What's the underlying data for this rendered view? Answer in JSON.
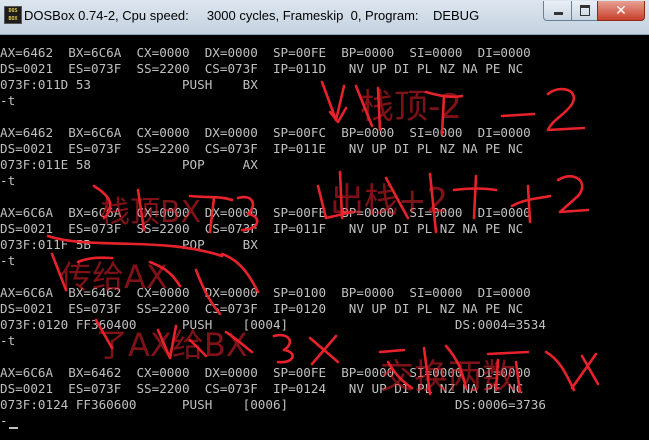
{
  "window": {
    "title": "DOSBox 0.74-2, Cpu speed:     3000 cycles, Frameskip  0, Program:    DEBUG",
    "app_icon": "dosbox-icon",
    "controls": [
      "minimize-icon",
      "maximize-icon",
      "close-icon"
    ],
    "close_color": "#c7402b"
  },
  "console": {
    "text_color": "#c0c0c0",
    "background": "#000000",
    "lines": [
      "AX=6462  BX=6C6A  CX=0000  DX=0000  SP=00FE  BP=0000  SI=0000  DI=0000",
      "DS=0021  ES=073F  SS=2200  CS=073F  IP=011D   NV UP DI PL NZ NA PE NC",
      "073F:011D 53            PUSH    BX",
      "-t",
      "",
      "AX=6462  BX=6C6A  CX=0000  DX=0000  SP=00FC  BP=0000  SI=0000  DI=0000",
      "DS=0021  ES=073F  SS=2200  CS=073F  IP=011E   NV UP DI PL NZ NA PE NC",
      "073F:011E 58            POP     AX",
      "-t",
      "",
      "AX=6C6A  BX=6C6A  CX=0000  DX=0000  SP=00FE  BP=0000  SI=0000  DI=0000",
      "DS=0021  ES=073F  SS=2200  CS=073F  IP=011F   NV UP DI PL NZ NA PE NC",
      "073F:011F 5B            POP     BX",
      "-t",
      "",
      "AX=6C6A  BX=6462  CX=0000  DX=0000  SP=0100  BP=0000  SI=0000  DI=0000",
      "DS=0021  ES=073F  SS=2200  CS=073F  IP=0120   NV UP DI PL NZ NA PE NC",
      "073F:0120 FF360400      PUSH    [0004]                      DS:0004=3534",
      "-t",
      "",
      "AX=6C6A  BX=6462  CX=0000  DX=0000  SP=00FE  BP=0000  SI=0000  DI=0000",
      "DS=0021  ES=073F  SS=2200  CS=073F  IP=0124   NV UP DI PL NZ NA PE NC",
      "073F:0124 FF360600      PUSH    [0006]                      DS:0006=3736",
      "-"
    ]
  },
  "annotations": {
    "ink_color": "#e8222b",
    "notes": [
      "栈顶-2",
      "出栈+2",
      "栈顶BX",
      "传给AX",
      "了AX给BX",
      "交换两数"
    ]
  }
}
